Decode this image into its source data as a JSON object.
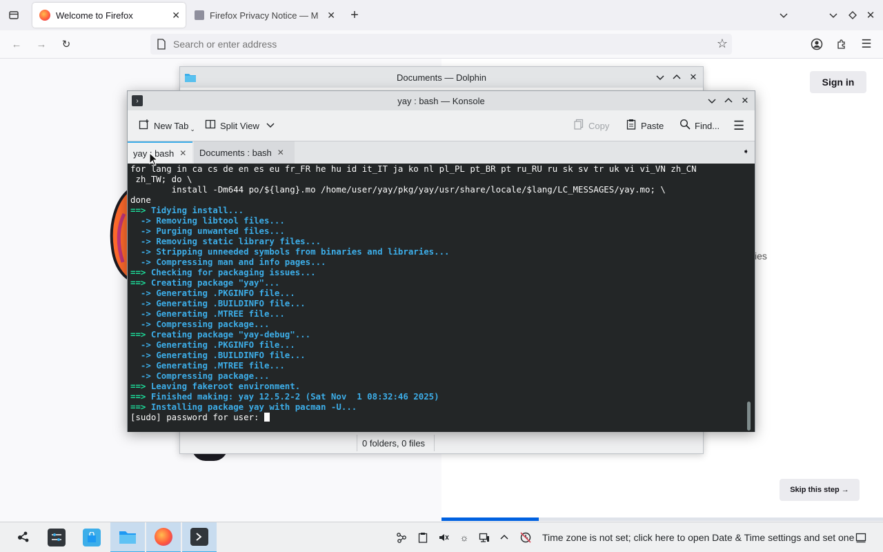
{
  "firefox": {
    "tabs": [
      {
        "label": "Welcome to Firefox",
        "active": true
      },
      {
        "label": "Firefox Privacy Notice — M",
        "active": false
      }
    ],
    "url_placeholder": "Search or enter address",
    "sign_in": "Sign in",
    "skip_step": "Skip this step →",
    "partial_text": "ies",
    "progress": 0.22
  },
  "dolphin": {
    "title": "Documents — Dolphin",
    "status": "0 folders, 0 files"
  },
  "konsole": {
    "title": "yay : bash — Konsole",
    "toolbar": {
      "new_tab": "New Tab",
      "split_view": "Split View",
      "copy": "Copy",
      "paste": "Paste",
      "find": "Find..."
    },
    "tabs": [
      {
        "label": "yay : bash",
        "active": true
      },
      {
        "label": "Documents : bash",
        "active": false
      }
    ],
    "lines": [
      {
        "parts": [
          {
            "t": "for lang in ca cs de en es eu fr_FR he hu id it_IT ja ko nl pl_PL pt_BR pt ru_RU ru sk sv tr uk vi vi_VN zh_CN",
            "c": "white"
          }
        ]
      },
      {
        "parts": [
          {
            "t": " zh_TW; do \\",
            "c": "white"
          }
        ]
      },
      {
        "parts": [
          {
            "t": "        install -Dm644 po/${lang}.mo /home/user/yay/pkg/yay/usr/share/locale/$lang/LC_MESSAGES/yay.mo; \\",
            "c": "white"
          }
        ]
      },
      {
        "parts": [
          {
            "t": "done",
            "c": "white"
          }
        ]
      },
      {
        "parts": [
          {
            "t": "==> ",
            "c": "green"
          },
          {
            "t": "Tidying install...",
            "c": "blue"
          }
        ]
      },
      {
        "parts": [
          {
            "t": "  -> ",
            "c": "blue"
          },
          {
            "t": "Removing libtool files...",
            "c": "blue"
          }
        ]
      },
      {
        "parts": [
          {
            "t": "  -> ",
            "c": "blue"
          },
          {
            "t": "Purging unwanted files...",
            "c": "blue"
          }
        ]
      },
      {
        "parts": [
          {
            "t": "  -> ",
            "c": "blue"
          },
          {
            "t": "Removing static library files...",
            "c": "blue"
          }
        ]
      },
      {
        "parts": [
          {
            "t": "  -> ",
            "c": "blue"
          },
          {
            "t": "Stripping unneeded symbols from binaries and libraries...",
            "c": "blue"
          }
        ]
      },
      {
        "parts": [
          {
            "t": "  -> ",
            "c": "blue"
          },
          {
            "t": "Compressing man and info pages...",
            "c": "blue"
          }
        ]
      },
      {
        "parts": [
          {
            "t": "==> ",
            "c": "green"
          },
          {
            "t": "Checking for packaging issues...",
            "c": "blue"
          }
        ]
      },
      {
        "parts": [
          {
            "t": "==> ",
            "c": "green"
          },
          {
            "t": "Creating package \"yay\"...",
            "c": "blue"
          }
        ]
      },
      {
        "parts": [
          {
            "t": "  -> ",
            "c": "blue"
          },
          {
            "t": "Generating .PKGINFO file...",
            "c": "blue"
          }
        ]
      },
      {
        "parts": [
          {
            "t": "  -> ",
            "c": "blue"
          },
          {
            "t": "Generating .BUILDINFO file...",
            "c": "blue"
          }
        ]
      },
      {
        "parts": [
          {
            "t": "  -> ",
            "c": "blue"
          },
          {
            "t": "Generating .MTREE file...",
            "c": "blue"
          }
        ]
      },
      {
        "parts": [
          {
            "t": "  -> ",
            "c": "blue"
          },
          {
            "t": "Compressing package...",
            "c": "blue"
          }
        ]
      },
      {
        "parts": [
          {
            "t": "==> ",
            "c": "green"
          },
          {
            "t": "Creating package \"yay-debug\"...",
            "c": "blue"
          }
        ]
      },
      {
        "parts": [
          {
            "t": "  -> ",
            "c": "blue"
          },
          {
            "t": "Generating .PKGINFO file...",
            "c": "blue"
          }
        ]
      },
      {
        "parts": [
          {
            "t": "  -> ",
            "c": "blue"
          },
          {
            "t": "Generating .BUILDINFO file...",
            "c": "blue"
          }
        ]
      },
      {
        "parts": [
          {
            "t": "  -> ",
            "c": "blue"
          },
          {
            "t": "Generating .MTREE file...",
            "c": "blue"
          }
        ]
      },
      {
        "parts": [
          {
            "t": "  -> ",
            "c": "blue"
          },
          {
            "t": "Compressing package...",
            "c": "blue"
          }
        ]
      },
      {
        "parts": [
          {
            "t": "==> ",
            "c": "green"
          },
          {
            "t": "Leaving fakeroot environment.",
            "c": "blue"
          }
        ]
      },
      {
        "parts": [
          {
            "t": "==> ",
            "c": "green"
          },
          {
            "t": "Finished making: yay 12.5.2-2 (Sat Nov  1 08:32:46 2025)",
            "c": "blue"
          }
        ]
      },
      {
        "parts": [
          {
            "t": "==> ",
            "c": "green"
          },
          {
            "t": "Installing package yay with pacman -U...",
            "c": "blue"
          }
        ]
      },
      {
        "parts": [
          {
            "t": "[sudo] password for user: ",
            "c": "white"
          }
        ],
        "cursor": true
      }
    ]
  },
  "taskbar": {
    "notification": "Time zone is not set; click here to open Date & Time settings and set one"
  }
}
